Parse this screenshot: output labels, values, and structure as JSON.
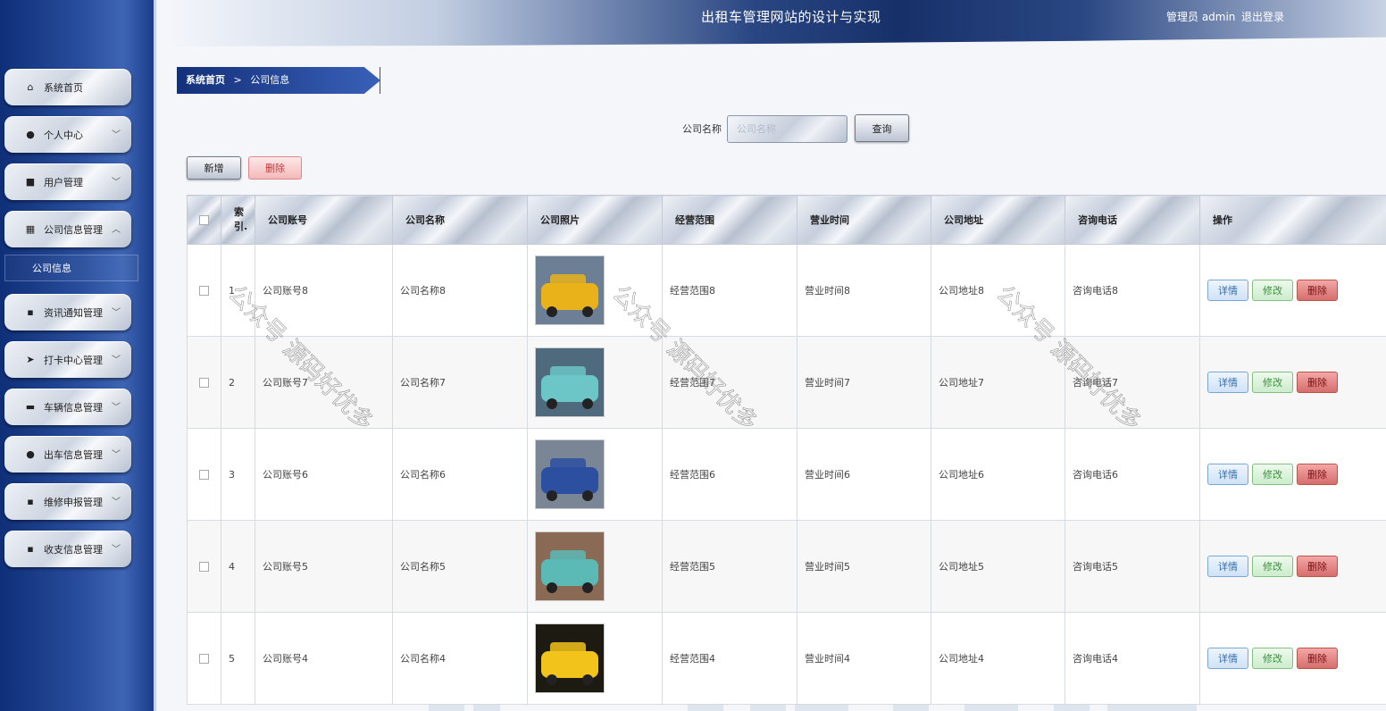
{
  "header": {
    "title": "出租车管理网站的设计与实现",
    "user": "管理员 admin",
    "logout": "退出登录"
  },
  "sidebar": {
    "items": [
      {
        "label": "系统首页",
        "icon": "home-icon",
        "glyph": "⌂",
        "has_chevron": false
      },
      {
        "label": "个人中心",
        "icon": "user-icon",
        "glyph": "●",
        "has_chevron": true
      },
      {
        "label": "用户管理",
        "icon": "id-card-icon",
        "glyph": "■",
        "has_chevron": true
      },
      {
        "label": "公司信息管理",
        "icon": "grid-icon",
        "glyph": "▦",
        "has_chevron": true,
        "expanded": true
      },
      {
        "label": "资讯通知管理",
        "icon": "grid-icon",
        "glyph": "▪",
        "has_chevron": true
      },
      {
        "label": "打卡中心管理",
        "icon": "send-icon",
        "glyph": "➤",
        "has_chevron": true
      },
      {
        "label": "车辆信息管理",
        "icon": "car-icon",
        "glyph": "▬",
        "has_chevron": true
      },
      {
        "label": "出车信息管理",
        "icon": "user-icon",
        "glyph": "●",
        "has_chevron": true
      },
      {
        "label": "维修申报管理",
        "icon": "grid-icon",
        "glyph": "▪",
        "has_chevron": true
      },
      {
        "label": "收支信息管理",
        "icon": "grid-icon",
        "glyph": "▪",
        "has_chevron": true
      }
    ],
    "sub_item": "公司信息"
  },
  "breadcrumb": {
    "home": "系统首页",
    "sep": ">",
    "current": "公司信息"
  },
  "search": {
    "label": "公司名称",
    "placeholder": "公司名称",
    "button": "查询"
  },
  "actions": {
    "add": "新增",
    "delete": "删除"
  },
  "table": {
    "headers": {
      "index": "索引.",
      "account": "公司账号",
      "name": "公司名称",
      "photo": "公司照片",
      "scope": "经营范围",
      "hours": "营业时间",
      "address": "公司地址",
      "phone": "咨询电话",
      "ops": "操作"
    },
    "op_labels": {
      "detail": "详情",
      "edit": "修改",
      "delete": "删除"
    },
    "rows": [
      {
        "index": "1",
        "account": "公司账号8",
        "name": "公司名称8",
        "scope": "经营范围8",
        "hours": "营业时间8",
        "address": "公司地址8",
        "phone": "咨询电话8",
        "photo": "yellow-taxi"
      },
      {
        "index": "2",
        "account": "公司账号7",
        "name": "公司名称7",
        "scope": "经营范围7",
        "hours": "营业时间7",
        "address": "公司地址7",
        "phone": "咨询电话7",
        "photo": "teal-taxi-front"
      },
      {
        "index": "3",
        "account": "公司账号6",
        "name": "公司名称6",
        "scope": "经营范围6",
        "hours": "营业时间6",
        "address": "公司地址6",
        "phone": "咨询电话6",
        "photo": "traffic-jam"
      },
      {
        "index": "4",
        "account": "公司账号5",
        "name": "公司名称5",
        "scope": "经营范围5",
        "hours": "营业时间5",
        "address": "公司地址5",
        "phone": "咨询电话5",
        "photo": "teal-taxi-side"
      },
      {
        "index": "5",
        "account": "公司账号4",
        "name": "公司名称4",
        "scope": "经营范围4",
        "hours": "营业时间4",
        "address": "公司地址4",
        "phone": "咨询电话4",
        "photo": "taxi-sign-night"
      }
    ]
  },
  "watermark": "公众号 源码好优多"
}
